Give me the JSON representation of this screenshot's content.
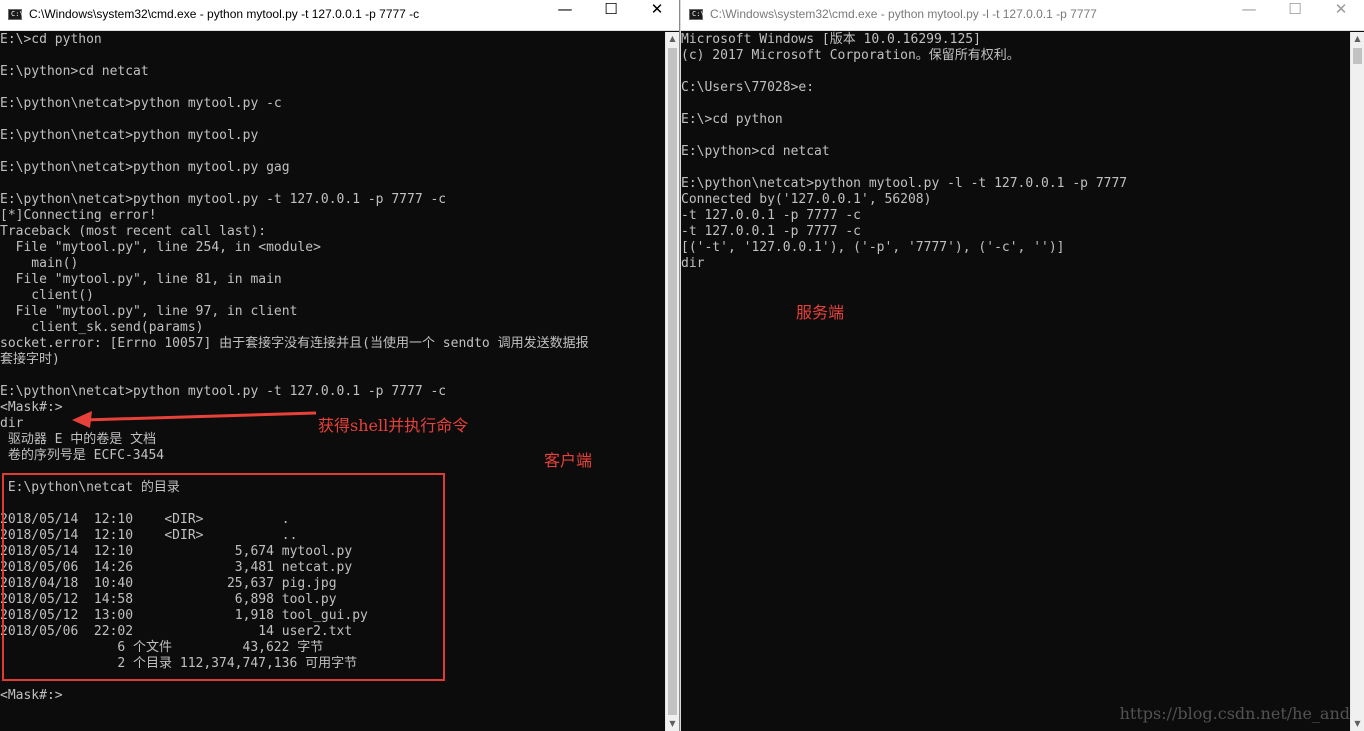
{
  "left_window": {
    "title": "C:\\Windows\\system32\\cmd.exe - python  mytool.py -t 127.0.0.1 -p 7777 -c",
    "icon_label": "C:\\",
    "minimize": "—",
    "maximize": "☐",
    "close": "✕",
    "lines": [
      "E:\\>cd python",
      "",
      "E:\\python>cd netcat",
      "",
      "E:\\python\\netcat>python mytool.py -c",
      "",
      "E:\\python\\netcat>python mytool.py",
      "",
      "E:\\python\\netcat>python mytool.py gag",
      "",
      "E:\\python\\netcat>python mytool.py -t 127.0.0.1 -p 7777 -c",
      "[*]Connecting error!",
      "Traceback (most recent call last):",
      "  File \"mytool.py\", line 254, in <module>",
      "    main()",
      "  File \"mytool.py\", line 81, in main",
      "    client()",
      "  File \"mytool.py\", line 97, in client",
      "    client_sk.send(params)",
      "socket.error: [Errno 10057] 由于套接字没有连接并且(当使用一个 sendto 调用发送数据报",
      "套接字时)",
      "",
      "E:\\python\\netcat>python mytool.py -t 127.0.0.1 -p 7777 -c",
      "<Mask#:>",
      "dir",
      " 驱动器 E 中的卷是 文档",
      " 卷的序列号是 ECFC-3454",
      "",
      " E:\\python\\netcat 的目录",
      "",
      "2018/05/14  12:10    <DIR>          .",
      "2018/05/14  12:10    <DIR>          ..",
      "2018/05/14  12:10             5,674 mytool.py",
      "2018/05/06  14:26             3,481 netcat.py",
      "2018/04/18  10:40            25,637 pig.jpg",
      "2018/05/12  14:58             6,898 tool.py",
      "2018/05/12  13:00             1,918 tool_gui.py",
      "2018/05/06  22:02                14 user2.txt",
      "               6 个文件         43,622 字节",
      "               2 个目录 112,374,747,136 可用字节",
      "",
      "<Mask#:>"
    ]
  },
  "right_window": {
    "title": "C:\\Windows\\system32\\cmd.exe - python  mytool.py -l -t 127.0.0.1 -p 7777",
    "icon_label": "C:\\",
    "minimize": "—",
    "maximize": "☐",
    "close": "✕",
    "lines": [
      "Microsoft Windows [版本 10.0.16299.125]",
      "(c) 2017 Microsoft Corporation。保留所有权利。",
      "",
      "C:\\Users\\77028>e:",
      "",
      "E:\\>cd python",
      "",
      "E:\\python>cd netcat",
      "",
      "E:\\python\\netcat>python mytool.py -l -t 127.0.0.1 -p 7777",
      "Connected by('127.0.0.1', 56208)",
      "-t 127.0.0.1 -p 7777 -c",
      "-t 127.0.0.1 -p 7777 -c",
      "[('-t', '127.0.0.1'), ('-p', '7777'), ('-c', '')]",
      "dir"
    ]
  },
  "annotations": {
    "arrow_label": "获得shell并执行命令",
    "client_label": "客户端",
    "server_label": "服务端",
    "color": "#e8413a"
  },
  "watermark": "https://blog.csdn.net/he_and"
}
